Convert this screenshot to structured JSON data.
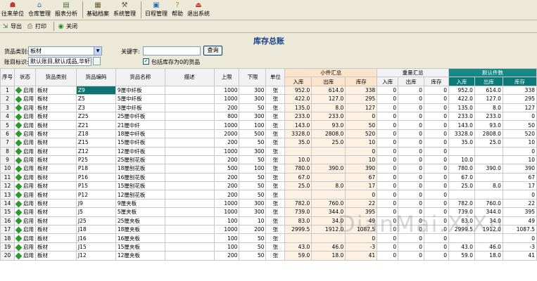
{
  "menu": [
    {
      "label": "往来单位",
      "icon": "contacts-icon"
    },
    {
      "label": "仓库管理",
      "icon": "warehouse-icon"
    },
    {
      "label": "报表分析",
      "icon": "report-icon"
    },
    {
      "label": "基础档案",
      "icon": "archive-icon"
    },
    {
      "label": "系统管理",
      "icon": "tools-icon"
    },
    {
      "label": "日程管理",
      "icon": "calendar-icon"
    },
    {
      "label": "帮助",
      "icon": "help-icon"
    },
    {
      "label": "退出系统",
      "icon": "exit-icon"
    }
  ],
  "toolbar": {
    "export": "导出",
    "print": "打印",
    "close": "关闭"
  },
  "title": "库存总账",
  "filters": {
    "category_label": "货品类别:",
    "category_value": "板材",
    "keyword_label": "关键字:",
    "keyword_value": "",
    "query_button": "查询",
    "account_label": "账目标识:",
    "account_value": "默认账目,默认成品,华轩阁",
    "zero_checkbox_label": "包括库存为0的货品",
    "zero_checked": true
  },
  "columns": {
    "seq": "序号",
    "state": "状态",
    "category": "货品类别",
    "code": "货品编码",
    "name": "货品名称",
    "desc": "描述",
    "upper": "上限",
    "lower": "下限",
    "unit": "单位",
    "group_small": "小件汇总",
    "group_weight": "重量汇总",
    "group_default": "默认件数",
    "in": "入库",
    "out": "出库",
    "stock": "库存"
  },
  "rows": [
    {
      "no": "1",
      "state": "启用",
      "cat": "板材",
      "code": "Z9",
      "name": "9厘中纤板",
      "desc": "",
      "up": "1000",
      "low": "300",
      "unit": "张",
      "s_in": "952.0",
      "s_out": "614.0",
      "s_st": "338",
      "w_in": "0",
      "w_out": "0",
      "w_st": "0",
      "d_in": "952.0",
      "d_out": "614.0",
      "d_st": "338"
    },
    {
      "no": "2",
      "state": "启用",
      "cat": "板材",
      "code": "Z5",
      "name": "5厘中纤板",
      "desc": "",
      "up": "1000",
      "low": "300",
      "unit": "张",
      "s_in": "422.0",
      "s_out": "127.0",
      "s_st": "295",
      "w_in": "0",
      "w_out": "0",
      "w_st": "0",
      "d_in": "422.0",
      "d_out": "127.0",
      "d_st": "295"
    },
    {
      "no": "3",
      "state": "启用",
      "cat": "板材",
      "code": "Z3",
      "name": "3厘中纤板",
      "desc": "",
      "up": "200",
      "low": "50",
      "unit": "张",
      "s_in": "135.0",
      "s_out": "8.0",
      "s_st": "127",
      "w_in": "0",
      "w_out": "0",
      "w_st": "0",
      "d_in": "135.0",
      "d_out": "8.0",
      "d_st": "127"
    },
    {
      "no": "4",
      "state": "启用",
      "cat": "板材",
      "code": "Z25",
      "name": "25厘中纤板",
      "desc": "",
      "up": "800",
      "low": "300",
      "unit": "张",
      "s_in": "233.0",
      "s_out": "233.0",
      "s_st": "0",
      "w_in": "0",
      "w_out": "0",
      "w_st": "0",
      "d_in": "233.0",
      "d_out": "233.0",
      "d_st": "0"
    },
    {
      "no": "5",
      "state": "启用",
      "cat": "板材",
      "code": "Z21",
      "name": "21厘中纤",
      "desc": "",
      "up": "1000",
      "low": "100",
      "unit": "张",
      "s_in": "143.0",
      "s_out": "93.0",
      "s_st": "50",
      "w_in": "0",
      "w_out": "0",
      "w_st": "0",
      "d_in": "143.0",
      "d_out": "93.0",
      "d_st": "50"
    },
    {
      "no": "6",
      "state": "启用",
      "cat": "板材",
      "code": "Z18",
      "name": "18厘中纤板",
      "desc": "",
      "up": "2000",
      "low": "500",
      "unit": "张",
      "s_in": "3328.0",
      "s_out": "2808.0",
      "s_st": "520",
      "w_in": "0",
      "w_out": "0",
      "w_st": "0",
      "d_in": "3328.0",
      "d_out": "2808.0",
      "d_st": "520"
    },
    {
      "no": "7",
      "state": "启用",
      "cat": "板材",
      "code": "Z15",
      "name": "15厘中纤板",
      "desc": "",
      "up": "200",
      "low": "50",
      "unit": "张",
      "s_in": "35.0",
      "s_out": "25.0",
      "s_st": "10",
      "w_in": "0",
      "w_out": "0",
      "w_st": "0",
      "d_in": "35.0",
      "d_out": "25.0",
      "d_st": "10"
    },
    {
      "no": "8",
      "state": "启用",
      "cat": "板材",
      "code": "Z12",
      "name": "12厘中纤板",
      "desc": "",
      "up": "1000",
      "low": "300",
      "unit": "张",
      "s_in": "",
      "s_out": "",
      "s_st": "0",
      "w_in": "0",
      "w_out": "0",
      "w_st": "0",
      "d_in": "",
      "d_out": "",
      "d_st": "0"
    },
    {
      "no": "9",
      "state": "启用",
      "cat": "板材",
      "code": "P25",
      "name": "25厘刨花板",
      "desc": "",
      "up": "200",
      "low": "50",
      "unit": "张",
      "s_in": "10.0",
      "s_out": "",
      "s_st": "10",
      "w_in": "0",
      "w_out": "0",
      "w_st": "0",
      "d_in": "10.0",
      "d_out": "",
      "d_st": "10"
    },
    {
      "no": "10",
      "state": "启用",
      "cat": "板材",
      "code": "P18",
      "name": "18厘刨花板",
      "desc": "",
      "up": "500",
      "low": "100",
      "unit": "张",
      "s_in": "780.0",
      "s_out": "390.0",
      "s_st": "390",
      "w_in": "0",
      "w_out": "0",
      "w_st": "0",
      "d_in": "780.0",
      "d_out": "390.0",
      "d_st": "390"
    },
    {
      "no": "11",
      "state": "启用",
      "cat": "板材",
      "code": "P16",
      "name": "16厘刨花板",
      "desc": "",
      "up": "200",
      "low": "50",
      "unit": "张",
      "s_in": "67.0",
      "s_out": "",
      "s_st": "67",
      "w_in": "0",
      "w_out": "0",
      "w_st": "0",
      "d_in": "67.0",
      "d_out": "",
      "d_st": "67"
    },
    {
      "no": "12",
      "state": "启用",
      "cat": "板材",
      "code": "P15",
      "name": "15厘刨花板",
      "desc": "",
      "up": "200",
      "low": "50",
      "unit": "张",
      "s_in": "25.0",
      "s_out": "8.0",
      "s_st": "17",
      "w_in": "0",
      "w_out": "0",
      "w_st": "0",
      "d_in": "25.0",
      "d_out": "8.0",
      "d_st": "17"
    },
    {
      "no": "13",
      "state": "启用",
      "cat": "板材",
      "code": "P12",
      "name": "12厘刨花板",
      "desc": "",
      "up": "200",
      "low": "50",
      "unit": "张",
      "s_in": "",
      "s_out": "",
      "s_st": "0",
      "w_in": "0",
      "w_out": "0",
      "w_st": "0",
      "d_in": "",
      "d_out": "",
      "d_st": "0"
    },
    {
      "no": "14",
      "state": "启用",
      "cat": "板材",
      "code": "J9",
      "name": "9厘夹板",
      "desc": "",
      "up": "1000",
      "low": "300",
      "unit": "张",
      "s_in": "782.0",
      "s_out": "760.0",
      "s_st": "22",
      "w_in": "0",
      "w_out": "0",
      "w_st": "0",
      "d_in": "782.0",
      "d_out": "760.0",
      "d_st": "22"
    },
    {
      "no": "15",
      "state": "启用",
      "cat": "板材",
      "code": "J5",
      "name": "5厘夹板",
      "desc": "",
      "up": "1000",
      "low": "300",
      "unit": "张",
      "s_in": "739.0",
      "s_out": "344.0",
      "s_st": "395",
      "w_in": "0",
      "w_out": "0",
      "w_st": "0",
      "d_in": "739.0",
      "d_out": "344.0",
      "d_st": "395"
    },
    {
      "no": "16",
      "state": "启用",
      "cat": "板材",
      "code": "J25",
      "name": "25厘夹板",
      "desc": "",
      "up": "100",
      "low": "10",
      "unit": "张",
      "s_in": "83.0",
      "s_out": "34.0",
      "s_st": "49",
      "w_in": "0",
      "w_out": "0",
      "w_st": "0",
      "d_in": "83.0",
      "d_out": "34.0",
      "d_st": "49"
    },
    {
      "no": "17",
      "state": "启用",
      "cat": "板材",
      "code": "J18",
      "name": "18厘夹板",
      "desc": "",
      "up": "1000",
      "low": "200",
      "unit": "张",
      "s_in": "2999.5",
      "s_out": "1912.0",
      "s_st": "1087.5",
      "w_in": "0",
      "w_out": "0",
      "w_st": "0",
      "d_in": "2999.5",
      "d_out": "1912.0",
      "d_st": "1087.5"
    },
    {
      "no": "18",
      "state": "启用",
      "cat": "板材",
      "code": "J16",
      "name": "16厘夹板",
      "desc": "",
      "up": "100",
      "low": "50",
      "unit": "张",
      "s_in": "",
      "s_out": "",
      "s_st": "0",
      "w_in": "0",
      "w_out": "0",
      "w_st": "0",
      "d_in": "",
      "d_out": "",
      "d_st": "0"
    },
    {
      "no": "19",
      "state": "启用",
      "cat": "板材",
      "code": "J15",
      "name": "15厘夹板",
      "desc": "",
      "up": "100",
      "low": "50",
      "unit": "张",
      "s_in": "43.0",
      "s_out": "46.0",
      "s_st": "-3",
      "w_in": "0",
      "w_out": "0",
      "w_st": "0",
      "d_in": "43.0",
      "d_out": "46.0",
      "d_st": "-3"
    },
    {
      "no": "20",
      "state": "启用",
      "cat": "板材",
      "code": "J12",
      "name": "12厘夹板",
      "desc": "",
      "up": "200",
      "low": "50",
      "unit": "张",
      "s_in": "59.0",
      "s_out": "18.0",
      "s_st": "41",
      "w_in": "0",
      "w_out": "0",
      "w_st": "0",
      "d_in": "59.0",
      "d_out": "18.0",
      "d_st": "41"
    }
  ],
  "watermark": "DianMai.XiXu"
}
